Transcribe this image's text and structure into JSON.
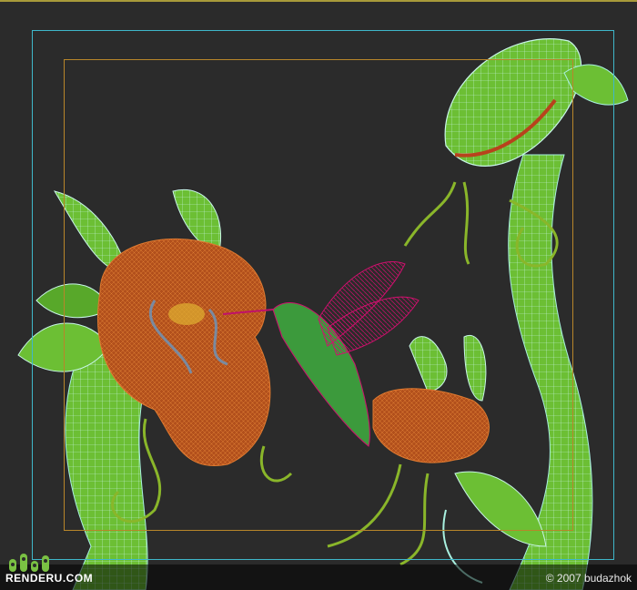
{
  "watermark": {
    "logo_text": "RENDERU.COM",
    "copyright": "© 2007 budazhok"
  },
  "colors": {
    "background": "#2b2b2b",
    "safe_frame": "#3fb7c9",
    "render_frame": "#b8862a",
    "stem_green": "#78c63a",
    "wire_cyan": "#9be9e3",
    "flower_orange": "#b5501c",
    "bird_magenta": "#c0106a",
    "bird_green": "#3c9a3c",
    "logo_green": "#7ac143"
  },
  "icons": {
    "logo": "renderu-logo-icon"
  }
}
